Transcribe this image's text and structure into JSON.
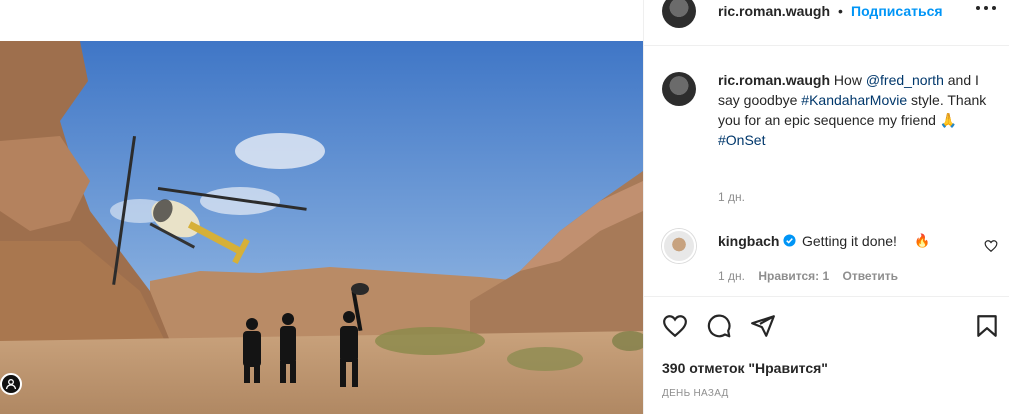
{
  "header": {
    "username": "ric.roman.waugh",
    "separator": "•",
    "follow_label": "Подписаться"
  },
  "caption": {
    "username": "ric.roman.waugh",
    "text_1": "How ",
    "mention": "@fred_north",
    "text_2": " and I say goodbye ",
    "hashtag_1": "#KandaharMovie",
    "text_3": " style. Thank you for an epic sequence my friend ",
    "emoji": "🙏",
    "hashtag_2": "#OnSet",
    "time": "1 дн."
  },
  "comment": {
    "username": "kingbach",
    "text": "Getting it done!",
    "emoji": "🔥",
    "time": "1 дн.",
    "likes": "Нравится: 1",
    "reply": "Ответить"
  },
  "post": {
    "likes_text": "390 отметок \"Нравится\"",
    "date_text": "ДЕНЬ НАЗАД"
  },
  "icons": {
    "more": "more-options-icon",
    "like": "heart-icon",
    "comment": "comment-icon",
    "share": "share-icon",
    "save": "bookmark-icon",
    "verified": "verified-badge-icon",
    "tag": "user-tag-icon"
  },
  "colors": {
    "link": "#00376b",
    "follow": "#0095f6",
    "verified": "#0095f6",
    "muted": "#8e8e8e"
  }
}
